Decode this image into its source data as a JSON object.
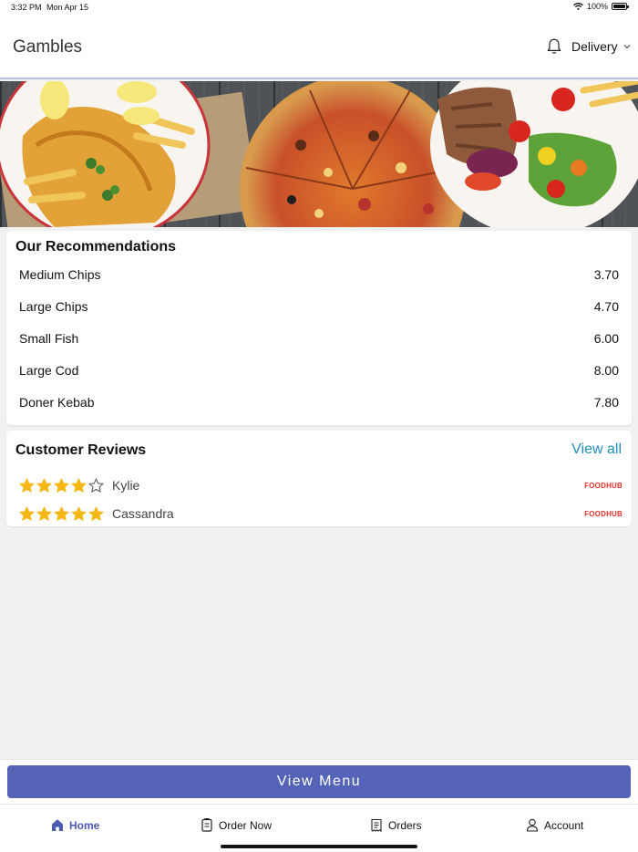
{
  "status_bar": {
    "time": "3:32 PM",
    "date": "Mon Apr 15",
    "battery": "100%",
    "battery_level": 1.0
  },
  "header": {
    "title": "Gambles",
    "delivery_label": "Delivery"
  },
  "recommendations": {
    "title": "Our Recommendations",
    "items": [
      {
        "name": "Medium Chips",
        "price": "3.70"
      },
      {
        "name": "Large Chips",
        "price": "4.70"
      },
      {
        "name": "Small Fish",
        "price": "6.00"
      },
      {
        "name": "Large Cod",
        "price": "8.00"
      },
      {
        "name": "Doner Kebab",
        "price": "7.80"
      }
    ]
  },
  "reviews": {
    "title": "Customer Reviews",
    "view_all_label": "View all",
    "items": [
      {
        "name": "Kylie",
        "rating": 4,
        "source": "FOODHUB"
      },
      {
        "name": "Cassandra",
        "rating": 5,
        "source": "FOODHUB"
      }
    ]
  },
  "view_menu_label": "View Menu",
  "tabs": [
    {
      "label": "Home",
      "icon": "home-icon",
      "active": true
    },
    {
      "label": "Order Now",
      "icon": "order-icon",
      "active": false
    },
    {
      "label": "Orders",
      "icon": "receipt-icon",
      "active": false
    },
    {
      "label": "Account",
      "icon": "person-icon",
      "active": false
    }
  ],
  "colors": {
    "accent": "#5564b8",
    "link": "#1e8fb6",
    "star": "#f6b714",
    "foodhub": "#e4332a"
  }
}
